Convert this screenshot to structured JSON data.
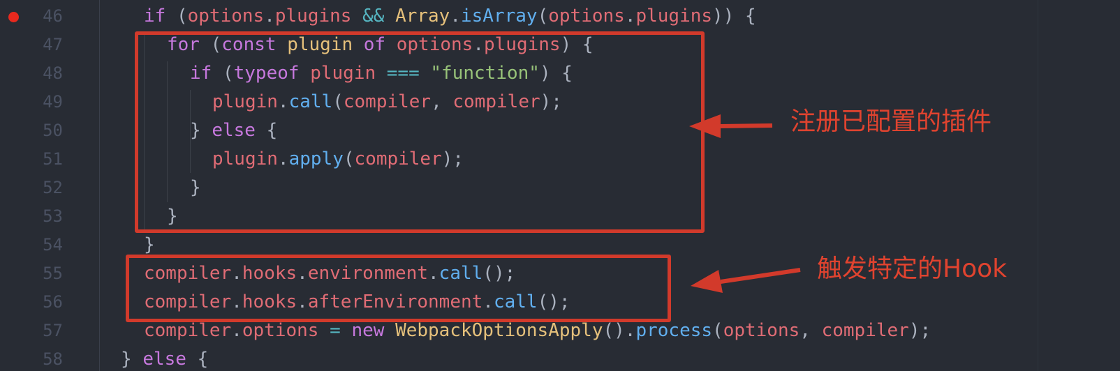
{
  "editor": {
    "breakpoint_line": "46",
    "line_numbers": [
      "46",
      "47",
      "48",
      "49",
      "50",
      "51",
      "52",
      "53",
      "54",
      "55",
      "56",
      "57",
      "58"
    ],
    "lines": [
      [
        [
          "kw",
          "if "
        ],
        [
          "pn",
          "("
        ],
        [
          "var",
          "options"
        ],
        [
          "pn",
          "."
        ],
        [
          "var",
          "plugins"
        ],
        [
          "pn",
          " "
        ],
        [
          "op",
          "&&"
        ],
        [
          "pn",
          " "
        ],
        [
          "cls",
          "Array"
        ],
        [
          "pn",
          "."
        ],
        [
          "fn",
          "isArray"
        ],
        [
          "pn",
          "("
        ],
        [
          "var",
          "options"
        ],
        [
          "pn",
          "."
        ],
        [
          "var",
          "plugins"
        ],
        [
          "pn",
          ")) {"
        ]
      ],
      [
        [
          "kw",
          "for "
        ],
        [
          "pn",
          "("
        ],
        [
          "kw",
          "const "
        ],
        [
          "cls",
          "plugin "
        ],
        [
          "kw",
          "of "
        ],
        [
          "var",
          "options"
        ],
        [
          "pn",
          "."
        ],
        [
          "var",
          "plugins"
        ],
        [
          "pn",
          ") {"
        ]
      ],
      [
        [
          "kw",
          "if "
        ],
        [
          "pn",
          "("
        ],
        [
          "kw",
          "typeof "
        ],
        [
          "var",
          "plugin "
        ],
        [
          "op",
          "==="
        ],
        [
          "pn",
          " "
        ],
        [
          "str",
          "\"function\""
        ],
        [
          "pn",
          ") {"
        ]
      ],
      [
        [
          "var",
          "plugin"
        ],
        [
          "pn",
          "."
        ],
        [
          "fn",
          "call"
        ],
        [
          "pn",
          "("
        ],
        [
          "var",
          "compiler"
        ],
        [
          "pn",
          ", "
        ],
        [
          "var",
          "compiler"
        ],
        [
          "pn",
          ");"
        ]
      ],
      [
        [
          "pn",
          "} "
        ],
        [
          "kw",
          "else "
        ],
        [
          "pn",
          "{"
        ]
      ],
      [
        [
          "var",
          "plugin"
        ],
        [
          "pn",
          "."
        ],
        [
          "fn",
          "apply"
        ],
        [
          "pn",
          "("
        ],
        [
          "var",
          "compiler"
        ],
        [
          "pn",
          ");"
        ]
      ],
      [
        [
          "pn",
          "}"
        ]
      ],
      [
        [
          "pn",
          "}"
        ]
      ],
      [
        [
          "pn",
          "}"
        ]
      ],
      [
        [
          "var",
          "compiler"
        ],
        [
          "pn",
          "."
        ],
        [
          "var",
          "hooks"
        ],
        [
          "pn",
          "."
        ],
        [
          "var",
          "environment"
        ],
        [
          "pn",
          "."
        ],
        [
          "fn",
          "call"
        ],
        [
          "pn",
          "();"
        ]
      ],
      [
        [
          "var",
          "compiler"
        ],
        [
          "pn",
          "."
        ],
        [
          "var",
          "hooks"
        ],
        [
          "pn",
          "."
        ],
        [
          "var",
          "afterEnvironment"
        ],
        [
          "pn",
          "."
        ],
        [
          "fn",
          "call"
        ],
        [
          "pn",
          "();"
        ]
      ],
      [
        [
          "var",
          "compiler"
        ],
        [
          "pn",
          "."
        ],
        [
          "var",
          "options"
        ],
        [
          "pn",
          " "
        ],
        [
          "op",
          "="
        ],
        [
          "pn",
          " "
        ],
        [
          "kw",
          "new "
        ],
        [
          "cls",
          "WebpackOptionsApply"
        ],
        [
          "pn",
          "()."
        ],
        [
          "fn",
          "process"
        ],
        [
          "pn",
          "("
        ],
        [
          "var",
          "options"
        ],
        [
          "pn",
          ", "
        ],
        [
          "var",
          "compiler"
        ],
        [
          "pn",
          ");"
        ]
      ],
      [
        [
          "pn",
          "} "
        ],
        [
          "kw",
          "else "
        ],
        [
          "pn",
          "{"
        ]
      ]
    ],
    "colors": {
      "background": "#282c34",
      "keyword": "#c678dd",
      "variable": "#e06c75",
      "class": "#e5c07b",
      "function": "#61afef",
      "string": "#98c379",
      "operator": "#56b6c2",
      "punctuation": "#abb2bf",
      "line_number": "#4b5263",
      "breakpoint": "#e8291e"
    }
  },
  "annotations": {
    "register_plugins_label": "注册已配置的插件",
    "trigger_hooks_label": "触发特定的Hook",
    "color": "#d23a2b"
  }
}
